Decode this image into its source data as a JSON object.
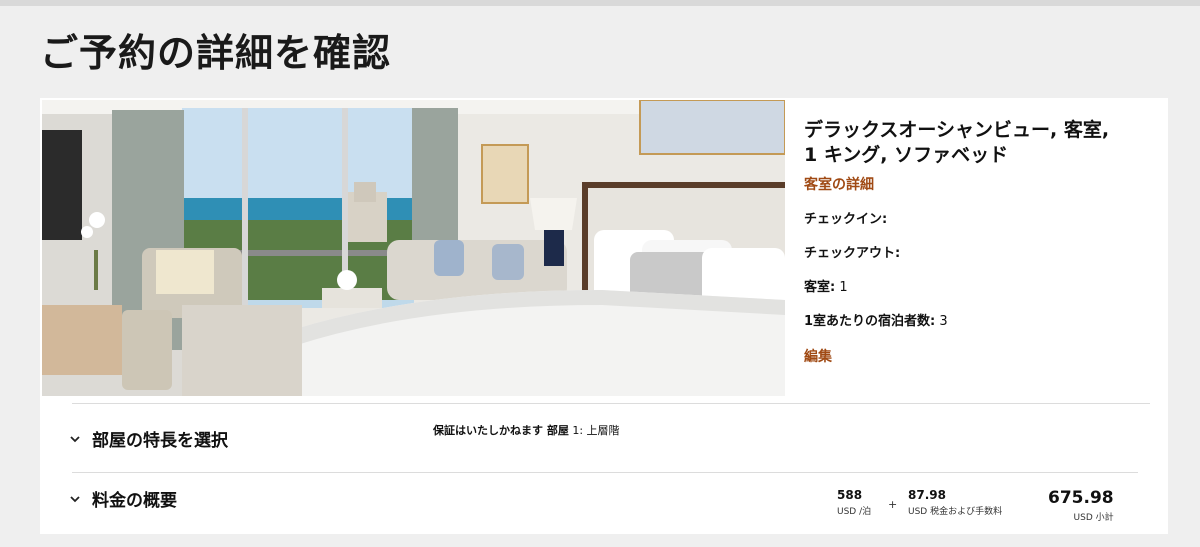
{
  "page": {
    "title": "ご予約の詳細を確認"
  },
  "room": {
    "name_line1": "デラックスオーシャンビュー, 客室,",
    "name_line2": "1 キング, ソファベッド",
    "details_link": "客室の詳細",
    "checkin_label": "チェックイン:",
    "checkin_value": "",
    "checkout_label": "チェックアウト:",
    "checkout_value": "",
    "rooms_label": "客室:",
    "rooms_value": "1",
    "guests_label": "1室あたりの宿泊者数:",
    "guests_value": "3",
    "edit_link": "編集"
  },
  "features": {
    "label": "部屋の特長を選択",
    "guarantee_bold": "保証はいたしかねます 部屋",
    "guarantee_rest": "1: 上層階"
  },
  "pricing": {
    "label": "料金の概要",
    "rate_value": "588",
    "rate_unit": "USD /泊",
    "plus": "+",
    "tax_value": "87.98",
    "tax_unit": "USD 税金および手数料",
    "subtotal_value": "675.98",
    "subtotal_unit": "USD 小計"
  },
  "colors": {
    "accent": "#a04a14",
    "background": "#efefef",
    "card": "#ffffff"
  },
  "icons": {
    "features_chevron": "chevron-down-icon",
    "pricing_chevron": "chevron-down-icon"
  }
}
